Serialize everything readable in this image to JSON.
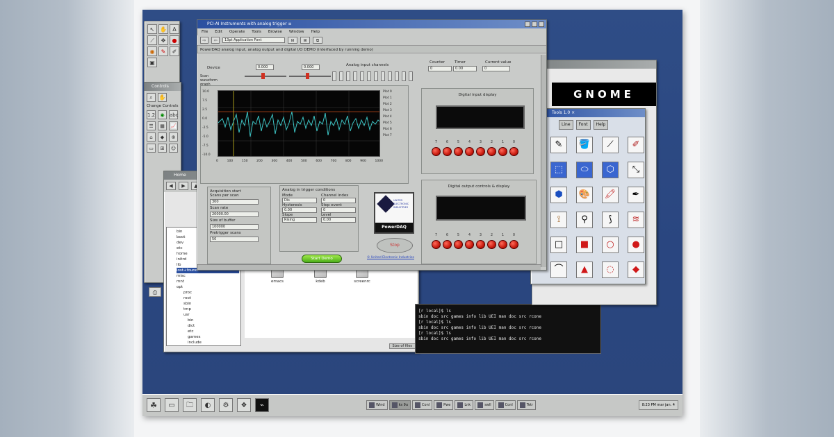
{
  "app": {
    "window_title": "PCI-AI Instruments with analog trigger ≡",
    "menu": [
      "File",
      "Edit",
      "Operate",
      "Tools",
      "Browse",
      "Window",
      "Help"
    ],
    "toolbar_font": "13pt Application Font",
    "banner": "PowerDAQ analog input, analog output and digital I/O DEMO (interfaced by running demo)",
    "scan_label": "Device",
    "scan_waveform": "Scan waveform graph",
    "ai_field": "0.000",
    "analog_input_channels": "Analog input channels",
    "counter_label": "Counter",
    "timer_label": "Timer",
    "current_value_label": "Current value",
    "counter_value": "0",
    "timer_value": "0.00",
    "current_value": "0",
    "chart_ticks_y": [
      "10.0",
      "7.5",
      "2.5",
      "0.0",
      "-2.5",
      "-5.0",
      "-7.5",
      "-10.0"
    ],
    "chart_ticks_x": [
      "0",
      "100",
      "150",
      "200",
      "300",
      "400",
      "500",
      "600",
      "700",
      "800",
      "900",
      "1000"
    ],
    "plot_labels": [
      "Plot 0",
      "Plot 1",
      "Plot 2",
      "Plot 3",
      "Plot 4",
      "Plot 5",
      "Plot 6",
      "Plot 7"
    ],
    "digital_input_display": "Digital input display",
    "digital_output_display": "Digital output controls & display",
    "led_labels": [
      "7",
      "6",
      "5",
      "4",
      "3",
      "2",
      "1",
      "0"
    ],
    "acquisition": {
      "title": "Acquisition start",
      "scans_per_scan": "Scans per scan",
      "rows": [
        "300",
        "Scan rate",
        "20000.00",
        "Size of buffer",
        "100000",
        "Pretrigger scans",
        "50"
      ]
    },
    "trigger": {
      "title": "Analog in trigger conditions",
      "mode": "Mode",
      "channel_index": "Channel index",
      "left_rows": [
        "Dis",
        "Hysteresis",
        "0.00",
        "Slope",
        "Rising"
      ],
      "right_rows": [
        "0",
        "Stop event",
        "0",
        "Level",
        "0.00"
      ]
    },
    "start_button": "Start Demo",
    "stop_button": "Stop",
    "logo_text": "PowerDAQ",
    "logo_sub": "UNITED ELECTRONIC INDUSTRIES",
    "footer_link": "© United Electronic Industries"
  },
  "gnome": {
    "banner": "GNOME",
    "paint_title": "Tools 1.0 ×",
    "tabs": [
      "Line",
      "Font",
      "Help"
    ],
    "tools": [
      "✎",
      "🪣",
      "⟋",
      "✐",
      "⬚",
      "⬭",
      "⬡",
      "⤡",
      "⬢",
      "🎨",
      "🖍",
      "✒",
      "⟟",
      "⚲",
      "⟆",
      "≋",
      "□",
      "■",
      "○",
      "●",
      "⌒",
      "▲",
      "◌",
      "◆"
    ]
  },
  "file_manager": {
    "title": "Home",
    "files_row1": [
      "bash_logout",
      "bash_profile",
      "bashrc"
    ],
    "files_row2": [
      "emacs",
      "kdeb",
      "screenrc"
    ],
    "tree": [
      "bin",
      "boot",
      "dev",
      "etc",
      "home",
      "initrd",
      "lib",
      "lost+found",
      "misc",
      "mnt",
      "opt",
      "proc",
      "root",
      "sbin",
      "tmp",
      "usr",
      "bin",
      "dict",
      "etc",
      "games",
      "include",
      "kerberos",
      "lib",
      "libexec",
      "local",
      "sbin",
      "share",
      "src",
      "X11R6"
    ],
    "status": "Size of files"
  },
  "terminal": {
    "lines": [
      "[r local]$ ls",
      "sbin  doc  src  games  info  lib  UEI  man  doc  src  rcone",
      "[r local]$ ls",
      "sbin  doc  src  games  info  lib  UEI  man  doc  src  rcone",
      "[r local]$ ls",
      "sbin  doc  src  games  info  lib  UEI  man  doc  src  rcone"
    ]
  },
  "sidebar_window": {
    "title": "Controls",
    "label": "Change Controls"
  },
  "taskbar": {
    "tasks": [
      "Wind",
      "ks 9u",
      "Conl",
      "Pwe",
      "Lnk",
      "swll",
      "Conl",
      "Tetr"
    ],
    "clock": "8:23 PM mar jan. 4"
  }
}
